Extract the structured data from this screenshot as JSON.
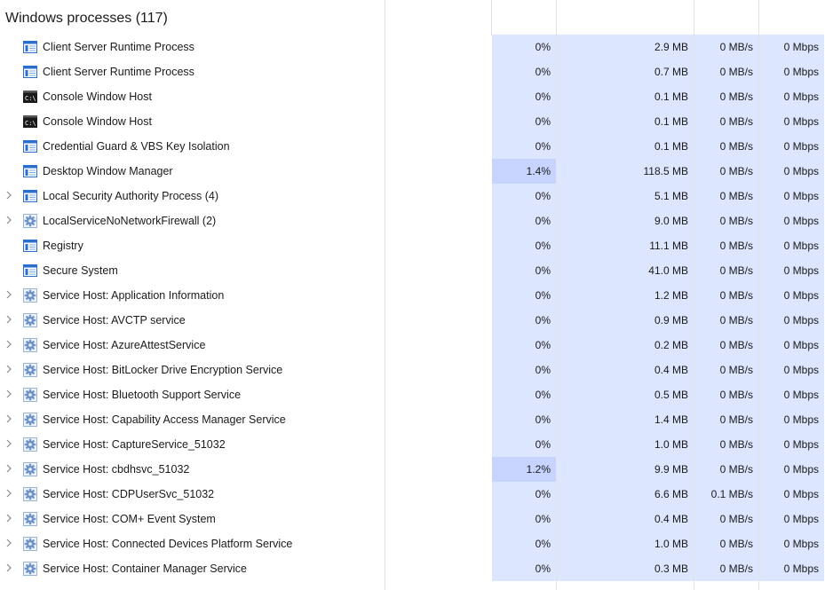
{
  "group": {
    "title": "Windows processes (117)"
  },
  "rows": [
    {
      "name": "Client Server Runtime Process",
      "icon": "window-process-icon",
      "expandable": false,
      "cpu": "0%",
      "memory": "2.9 MB",
      "disk": "0 MB/s",
      "network": "0 Mbps",
      "cpu_hot": false
    },
    {
      "name": "Client Server Runtime Process",
      "icon": "window-process-icon",
      "expandable": false,
      "cpu": "0%",
      "memory": "0.7 MB",
      "disk": "0 MB/s",
      "network": "0 Mbps",
      "cpu_hot": false
    },
    {
      "name": "Console Window Host",
      "icon": "console-icon",
      "expandable": false,
      "cpu": "0%",
      "memory": "0.1 MB",
      "disk": "0 MB/s",
      "network": "0 Mbps",
      "cpu_hot": false
    },
    {
      "name": "Console Window Host",
      "icon": "console-icon",
      "expandable": false,
      "cpu": "0%",
      "memory": "0.1 MB",
      "disk": "0 MB/s",
      "network": "0 Mbps",
      "cpu_hot": false
    },
    {
      "name": "Credential Guard & VBS Key Isolation",
      "icon": "window-process-icon",
      "expandable": false,
      "cpu": "0%",
      "memory": "0.1 MB",
      "disk": "0 MB/s",
      "network": "0 Mbps",
      "cpu_hot": false
    },
    {
      "name": "Desktop Window Manager",
      "icon": "window-process-icon",
      "expandable": false,
      "cpu": "1.4%",
      "memory": "118.5 MB",
      "disk": "0 MB/s",
      "network": "0 Mbps",
      "cpu_hot": true
    },
    {
      "name": "Local Security Authority Process (4)",
      "icon": "window-process-icon",
      "expandable": true,
      "cpu": "0%",
      "memory": "5.1 MB",
      "disk": "0 MB/s",
      "network": "0 Mbps",
      "cpu_hot": false
    },
    {
      "name": "LocalServiceNoNetworkFirewall (2)",
      "icon": "gear-icon",
      "expandable": true,
      "cpu": "0%",
      "memory": "9.0 MB",
      "disk": "0 MB/s",
      "network": "0 Mbps",
      "cpu_hot": false
    },
    {
      "name": "Registry",
      "icon": "window-process-icon",
      "expandable": false,
      "cpu": "0%",
      "memory": "11.1 MB",
      "disk": "0 MB/s",
      "network": "0 Mbps",
      "cpu_hot": false
    },
    {
      "name": "Secure System",
      "icon": "window-process-icon",
      "expandable": false,
      "cpu": "0%",
      "memory": "41.0 MB",
      "disk": "0 MB/s",
      "network": "0 Mbps",
      "cpu_hot": false
    },
    {
      "name": "Service Host: Application Information",
      "icon": "gear-icon",
      "expandable": true,
      "cpu": "0%",
      "memory": "1.2 MB",
      "disk": "0 MB/s",
      "network": "0 Mbps",
      "cpu_hot": false
    },
    {
      "name": "Service Host: AVCTP service",
      "icon": "gear-icon",
      "expandable": true,
      "cpu": "0%",
      "memory": "0.9 MB",
      "disk": "0 MB/s",
      "network": "0 Mbps",
      "cpu_hot": false
    },
    {
      "name": "Service Host: AzureAttestService",
      "icon": "gear-icon",
      "expandable": true,
      "cpu": "0%",
      "memory": "0.2 MB",
      "disk": "0 MB/s",
      "network": "0 Mbps",
      "cpu_hot": false
    },
    {
      "name": "Service Host: BitLocker Drive Encryption Service",
      "icon": "gear-icon",
      "expandable": true,
      "cpu": "0%",
      "memory": "0.4 MB",
      "disk": "0 MB/s",
      "network": "0 Mbps",
      "cpu_hot": false
    },
    {
      "name": "Service Host: Bluetooth Support Service",
      "icon": "gear-icon",
      "expandable": true,
      "cpu": "0%",
      "memory": "0.5 MB",
      "disk": "0 MB/s",
      "network": "0 Mbps",
      "cpu_hot": false
    },
    {
      "name": "Service Host: Capability Access Manager Service",
      "icon": "gear-icon",
      "expandable": true,
      "cpu": "0%",
      "memory": "1.4 MB",
      "disk": "0 MB/s",
      "network": "0 Mbps",
      "cpu_hot": false
    },
    {
      "name": "Service Host: CaptureService_51032",
      "icon": "gear-icon",
      "expandable": true,
      "cpu": "0%",
      "memory": "1.0 MB",
      "disk": "0 MB/s",
      "network": "0 Mbps",
      "cpu_hot": false
    },
    {
      "name": "Service Host: cbdhsvc_51032",
      "icon": "gear-icon",
      "expandable": true,
      "cpu": "1.2%",
      "memory": "9.9 MB",
      "disk": "0 MB/s",
      "network": "0 Mbps",
      "cpu_hot": true
    },
    {
      "name": "Service Host: CDPUserSvc_51032",
      "icon": "gear-icon",
      "expandable": true,
      "cpu": "0%",
      "memory": "6.6 MB",
      "disk": "0.1 MB/s",
      "network": "0 Mbps",
      "cpu_hot": false
    },
    {
      "name": "Service Host: COM+ Event System",
      "icon": "gear-icon",
      "expandable": true,
      "cpu": "0%",
      "memory": "0.4 MB",
      "disk": "0 MB/s",
      "network": "0 Mbps",
      "cpu_hot": false
    },
    {
      "name": "Service Host: Connected Devices Platform Service",
      "icon": "gear-icon",
      "expandable": true,
      "cpu": "0%",
      "memory": "1.0 MB",
      "disk": "0 MB/s",
      "network": "0 Mbps",
      "cpu_hot": false
    },
    {
      "name": "Service Host: Container Manager Service",
      "icon": "gear-icon",
      "expandable": true,
      "cpu": "0%",
      "memory": "0.3 MB",
      "disk": "0 MB/s",
      "network": "0 Mbps",
      "cpu_hot": false
    }
  ]
}
